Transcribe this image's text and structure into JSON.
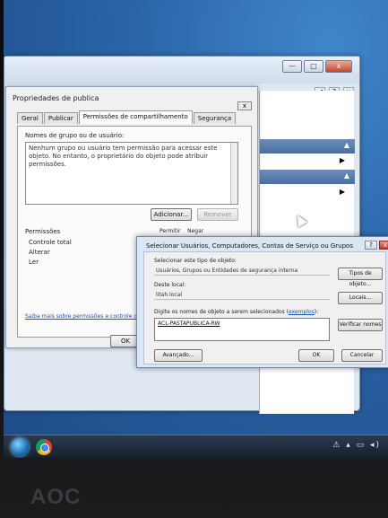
{
  "properties_dialog": {
    "title": "Propriedades de publica",
    "close_glyph": "x",
    "tabs": [
      "Geral",
      "Publicar",
      "Permissões de compartilhamento",
      "Segurança"
    ],
    "names_label": "Nomes de grupo ou de usuário:",
    "names_message": "Nenhum grupo ou usuário tem permissão para acessar este objeto. No entanto, o proprietário do objeto pode atribuir permissões.",
    "add_button": "Adicionar...",
    "remove_button": "Remover",
    "permissions_label": "Permissões",
    "permit_column": "Permitir",
    "deny_column": "Negar",
    "permissions": [
      "Controle total",
      "Alterar",
      "Ler"
    ],
    "help_link": "Saiba mais sobre permissões e controle d",
    "ok_button": "OK"
  },
  "select_dialog": {
    "title": "Selecionar Usuários, Computadores, Contas de Serviço ou Grupos",
    "help_glyph": "?",
    "close_glyph": "x",
    "object_type_label": "Selecionar este tipo de objeto:",
    "object_type_value": "Usuários, Grupos ou Entidades de segurança interna",
    "object_types_button": "Tipos de objeto...",
    "location_label": "Deste local:",
    "location_value": "litah.local",
    "locations_button": "Locais...",
    "names_prompt_prefix": "Digite os nomes de objeto a serem selecionados (",
    "names_prompt_link": "exemplos",
    "names_prompt_suffix": "):",
    "names_value": "ACL-PASTAPUBLICA-RW",
    "check_names_button": "Verificar nomes",
    "advanced_button": "Avançado...",
    "ok_button": "OK",
    "cancel_button": "Cancelar"
  },
  "background_window": {
    "controls": [
      "—",
      "□",
      "x"
    ],
    "pane_buttons": [
      "◀",
      "?",
      "x"
    ],
    "pane_arrows": [
      "▲",
      "▶",
      "▲",
      "▶"
    ]
  },
  "taskbar": {
    "tray_icons": "⚠ ▴ ▭ ◂)"
  },
  "monitor": {
    "brand": "AOC"
  }
}
